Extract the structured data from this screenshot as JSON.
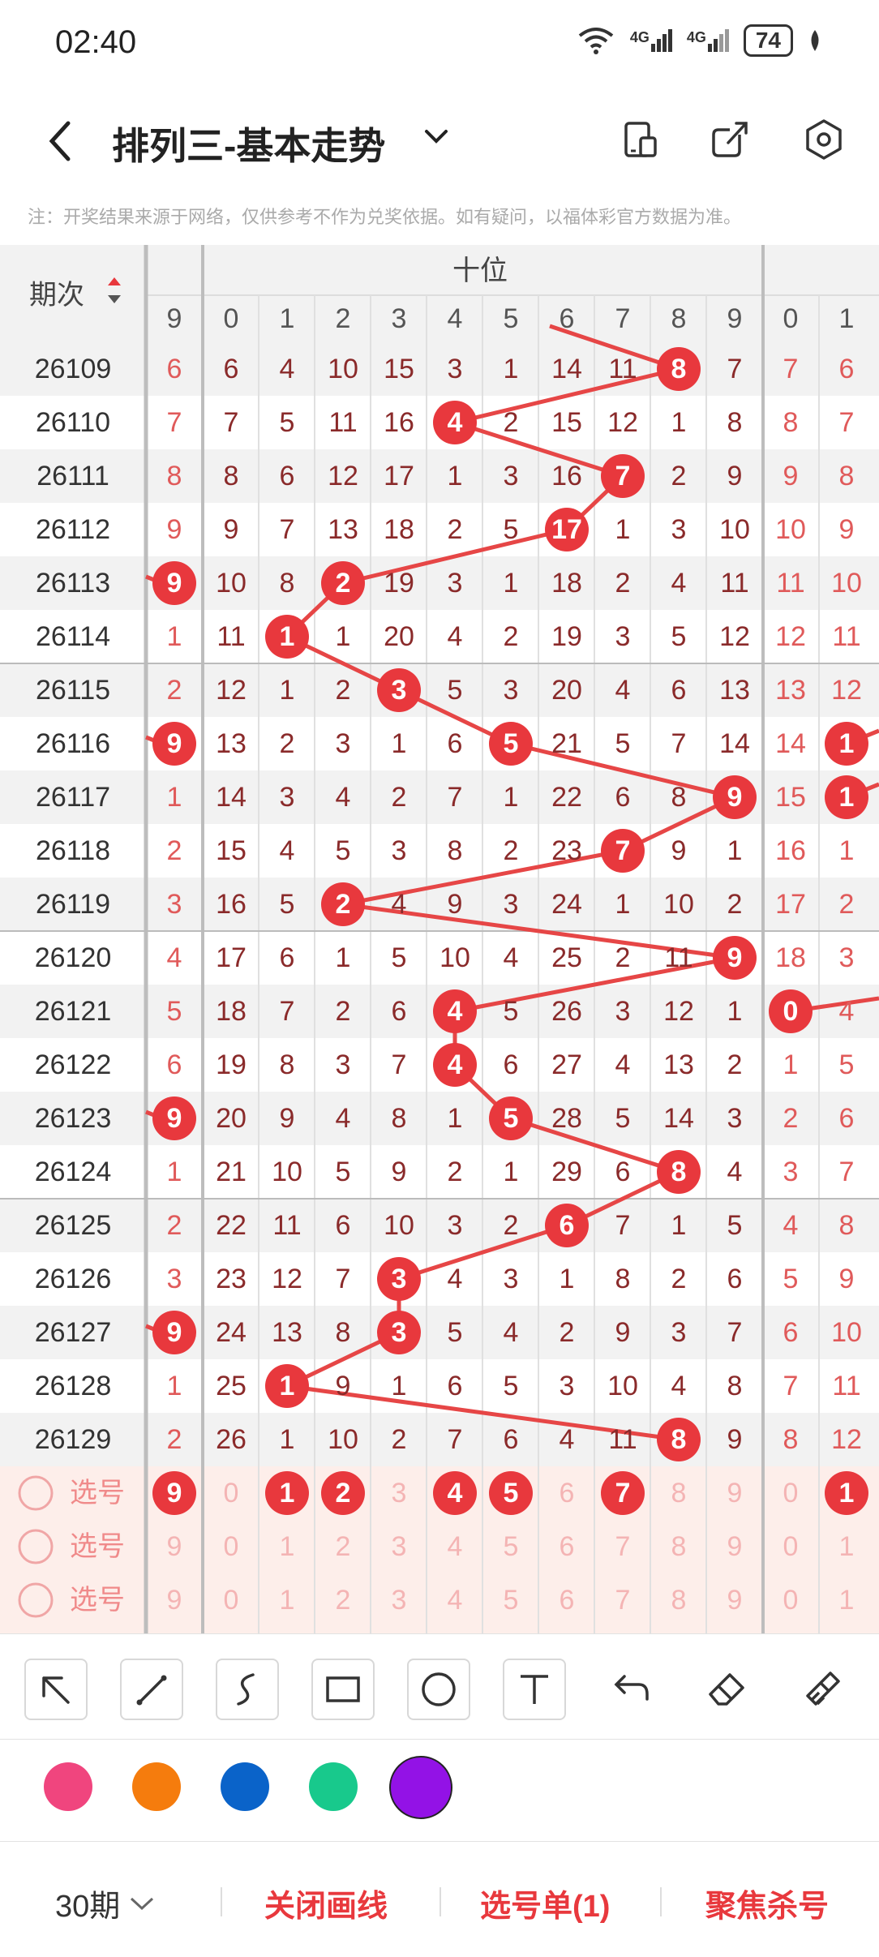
{
  "status_bar": {
    "time": "02:40",
    "network1": "4G",
    "network2": "4G",
    "battery": "74"
  },
  "header": {
    "title": "排列三-基本走势"
  },
  "note": "注：开奖结果来源于网络，仅供参考不作为兑奖依据。如有疑问，以福体彩官方数据为准。",
  "table": {
    "period_header": "期次",
    "group_header": "十位",
    "col_headers": [
      "9",
      "0",
      "1",
      "2",
      "3",
      "4",
      "5",
      "6",
      "7",
      "8",
      "9",
      "0",
      "1"
    ],
    "rows": [
      {
        "period": "26109",
        "cells": [
          "6",
          "6",
          "4",
          "10",
          "15",
          "3",
          "1",
          "14",
          "11",
          "8",
          "7",
          "7",
          "6"
        ]
      },
      {
        "period": "26110",
        "cells": [
          "7",
          "7",
          "5",
          "11",
          "16",
          "4",
          "2",
          "15",
          "12",
          "1",
          "8",
          "8",
          "7"
        ]
      },
      {
        "period": "26111",
        "cells": [
          "8",
          "8",
          "6",
          "12",
          "17",
          "1",
          "3",
          "16",
          "7",
          "2",
          "9",
          "9",
          "8"
        ]
      },
      {
        "period": "26112",
        "cells": [
          "9",
          "9",
          "7",
          "13",
          "18",
          "2",
          "5",
          "17",
          "1",
          "3",
          "10",
          "10",
          "9"
        ]
      },
      {
        "period": "26113",
        "cells": [
          "9",
          "10",
          "8",
          "2",
          "19",
          "3",
          "1",
          "18",
          "2",
          "4",
          "11",
          "11",
          "10"
        ]
      },
      {
        "period": "26114",
        "cells": [
          "1",
          "11",
          "1",
          "1",
          "20",
          "4",
          "2",
          "19",
          "3",
          "5",
          "12",
          "12",
          "11"
        ]
      },
      {
        "period": "26115",
        "cells": [
          "2",
          "12",
          "1",
          "2",
          "3",
          "5",
          "3",
          "20",
          "4",
          "6",
          "13",
          "13",
          "12"
        ]
      },
      {
        "period": "26116",
        "cells": [
          "9",
          "13",
          "2",
          "3",
          "1",
          "6",
          "5",
          "21",
          "5",
          "7",
          "14",
          "14",
          "1"
        ]
      },
      {
        "period": "26117",
        "cells": [
          "1",
          "14",
          "3",
          "4",
          "2",
          "7",
          "1",
          "22",
          "6",
          "8",
          "9",
          "15",
          "1"
        ]
      },
      {
        "period": "26118",
        "cells": [
          "2",
          "15",
          "4",
          "5",
          "3",
          "8",
          "2",
          "23",
          "7",
          "9",
          "1",
          "16",
          "1"
        ]
      },
      {
        "period": "26119",
        "cells": [
          "3",
          "16",
          "5",
          "2",
          "4",
          "9",
          "3",
          "24",
          "1",
          "10",
          "2",
          "17",
          "2"
        ]
      },
      {
        "period": "26120",
        "cells": [
          "4",
          "17",
          "6",
          "1",
          "5",
          "10",
          "4",
          "25",
          "2",
          "11",
          "9",
          "18",
          "3"
        ]
      },
      {
        "period": "26121",
        "cells": [
          "5",
          "18",
          "7",
          "2",
          "6",
          "4",
          "5",
          "26",
          "3",
          "12",
          "1",
          "0",
          "4"
        ]
      },
      {
        "period": "26122",
        "cells": [
          "6",
          "19",
          "8",
          "3",
          "7",
          "4",
          "6",
          "27",
          "4",
          "13",
          "2",
          "1",
          "5"
        ]
      },
      {
        "period": "26123",
        "cells": [
          "9",
          "20",
          "9",
          "4",
          "8",
          "1",
          "5",
          "28",
          "5",
          "14",
          "3",
          "2",
          "6"
        ]
      },
      {
        "period": "26124",
        "cells": [
          "1",
          "21",
          "10",
          "5",
          "9",
          "2",
          "1",
          "29",
          "6",
          "8",
          "4",
          "3",
          "7"
        ]
      },
      {
        "period": "26125",
        "cells": [
          "2",
          "22",
          "11",
          "6",
          "10",
          "3",
          "2",
          "6",
          "7",
          "1",
          "5",
          "4",
          "8"
        ]
      },
      {
        "period": "26126",
        "cells": [
          "3",
          "23",
          "12",
          "7",
          "3",
          "4",
          "3",
          "1",
          "8",
          "2",
          "6",
          "5",
          "9"
        ]
      },
      {
        "period": "26127",
        "cells": [
          "9",
          "24",
          "13",
          "8",
          "3",
          "5",
          "4",
          "2",
          "9",
          "3",
          "7",
          "6",
          "10"
        ]
      },
      {
        "period": "26128",
        "cells": [
          "1",
          "25",
          "1",
          "9",
          "1",
          "6",
          "5",
          "3",
          "10",
          "4",
          "8",
          "7",
          "11"
        ]
      },
      {
        "period": "26129",
        "cells": [
          "2",
          "26",
          "1",
          "10",
          "2",
          "7",
          "6",
          "4",
          "11",
          "8",
          "9",
          "8",
          "12"
        ]
      }
    ],
    "pick_label": "选号",
    "pick_rows": [
      [
        "9",
        "0",
        "1",
        "2",
        "3",
        "4",
        "5",
        "6",
        "7",
        "8",
        "9",
        "0",
        "1"
      ],
      [
        "9",
        "0",
        "1",
        "2",
        "3",
        "4",
        "5",
        "6",
        "7",
        "8",
        "9",
        "0",
        "1"
      ],
      [
        "9",
        "0",
        "1",
        "2",
        "3",
        "4",
        "5",
        "6",
        "7",
        "8",
        "9",
        "0",
        "1"
      ]
    ],
    "pick_selected_first_row": [
      true,
      false,
      true,
      true,
      false,
      true,
      true,
      false,
      true,
      false,
      false,
      false,
      true
    ]
  },
  "draw_tools": [
    "arrow-tool",
    "line-tool",
    "curve-tool",
    "rectangle-tool",
    "circle-tool",
    "text-tool",
    "undo-tool",
    "eraser-tool",
    "clear-tool"
  ],
  "palette": [
    "#f0457e",
    "#f57c0d",
    "#0a63c9",
    "#18c98c",
    "#9312e6"
  ],
  "footer": {
    "period": "30期",
    "close_draw": "关闭画线",
    "pick_list": "选号单(1)",
    "focus_kill": "聚焦杀号"
  },
  "colors": {
    "accent": "#e8383d",
    "line": "#e64646",
    "pick_bg": "#fdeeea"
  }
}
